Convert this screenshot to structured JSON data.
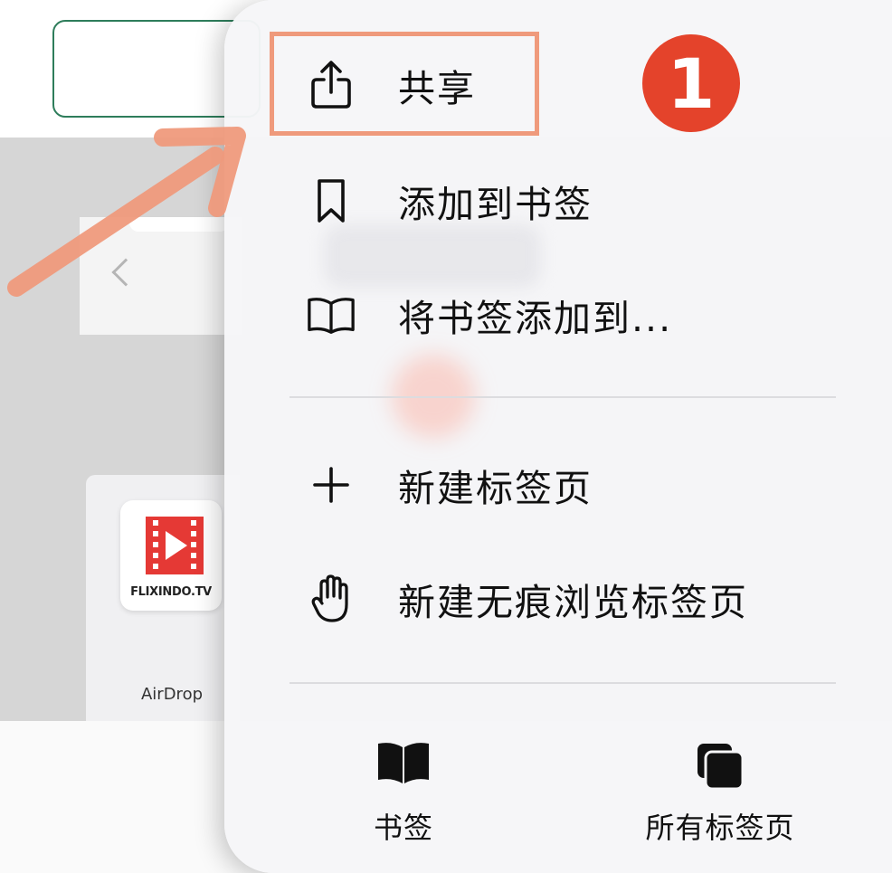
{
  "background": {
    "app_tile_label": "FLIXINDO.TV",
    "airdrop_label": "AirDrop"
  },
  "menu": {
    "items": [
      {
        "label": "共享",
        "icon": "share-icon"
      },
      {
        "label": "添加到书签",
        "icon": "bookmark-icon"
      },
      {
        "label": "将书签添加到...",
        "icon": "book-icon"
      },
      {
        "label": "新建标签页",
        "icon": "plus-icon"
      },
      {
        "label": "新建无痕浏览标签页",
        "icon": "hand-icon"
      }
    ],
    "bottom": {
      "bookmarks_label": "书签",
      "all_tabs_label": "所有标签页"
    }
  },
  "annotation": {
    "step_number": "1",
    "highlight_color": "#ef9a7c",
    "badge_color": "#e4432b"
  }
}
